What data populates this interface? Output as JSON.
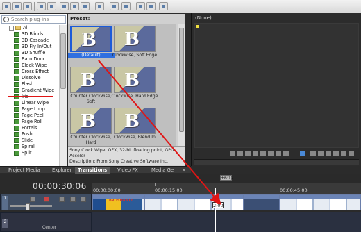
{
  "toolbar": {
    "icons": [
      "new-icon",
      "open-icon",
      "save-icon",
      "undo-icon",
      "redo-icon",
      "cut-icon",
      "copy-icon",
      "paste-icon",
      "ripple-icon",
      "snap-icon",
      "lock-icon",
      "selection-icon",
      "envelope-icon",
      "fx-icon"
    ]
  },
  "plugins": {
    "search_placeholder": "Search plug-ins",
    "items": [
      {
        "label": "All",
        "kind": "folder",
        "expander": "-"
      },
      {
        "label": "3D Blinds",
        "kind": "fx"
      },
      {
        "label": "3D Cascade",
        "kind": "fx"
      },
      {
        "label": "3D Fly In/Out",
        "kind": "fx"
      },
      {
        "label": "3D Shuffle",
        "kind": "fx"
      },
      {
        "label": "Barn Door",
        "kind": "fx"
      },
      {
        "label": "Clock Wipe",
        "kind": "fx",
        "selected": true
      },
      {
        "label": "Cross Effect",
        "kind": "fx"
      },
      {
        "label": "Dissolve",
        "kind": "fx"
      },
      {
        "label": "Flash",
        "kind": "fx"
      },
      {
        "label": "Gradient Wipe",
        "kind": "fx"
      },
      {
        "label": "Iris",
        "kind": "fx"
      },
      {
        "label": "Linear Wipe",
        "kind": "fx"
      },
      {
        "label": "Page Loop",
        "kind": "fx"
      },
      {
        "label": "Page Peel",
        "kind": "fx"
      },
      {
        "label": "Page Roll",
        "kind": "fx"
      },
      {
        "label": "Portals",
        "kind": "fx"
      },
      {
        "label": "Push",
        "kind": "fx"
      },
      {
        "label": "Slide",
        "kind": "fx"
      },
      {
        "label": "Spiral",
        "kind": "fx"
      },
      {
        "label": "Split",
        "kind": "fx"
      }
    ]
  },
  "preset": {
    "label": "Preset:",
    "tiles": [
      {
        "caption": "(Default)",
        "selected": true
      },
      {
        "caption": "Clockwise, Soft Edge"
      },
      {
        "caption": "Counter Clockwise, Soft"
      },
      {
        "caption": "Clockwise, Hard Edge"
      },
      {
        "caption": "Counter Clockwise, Hard"
      },
      {
        "caption": "Clockwise, Blend In"
      }
    ],
    "description_line1": "Sony Clock Wipe: OFX, 32-bit floating point, GPU Acceler",
    "description_line2": "Description: From Sony Creative Software Inc."
  },
  "preview": {
    "title": "(None)"
  },
  "tabs": {
    "items": [
      "Project Media",
      "Explorer",
      "Transitions",
      "Video FX",
      "Media Ge"
    ],
    "active": "Transitions",
    "close": "×"
  },
  "timeline": {
    "timecode": "00:00:30:06",
    "ruler_labels": [
      "00:00:00:00",
      "00:00:15:00",
      "00:00:45:00"
    ],
    "marker": "+6:12",
    "track1_number": "1",
    "track2_number": "2",
    "track2_label": "Center",
    "clip_text": "BROSHANTE",
    "cursor_time": "2:00"
  },
  "colors": {
    "accent_selection": "#2f6fe0",
    "annotation_red": "#e01515",
    "track_blue": "#3b4f74"
  }
}
